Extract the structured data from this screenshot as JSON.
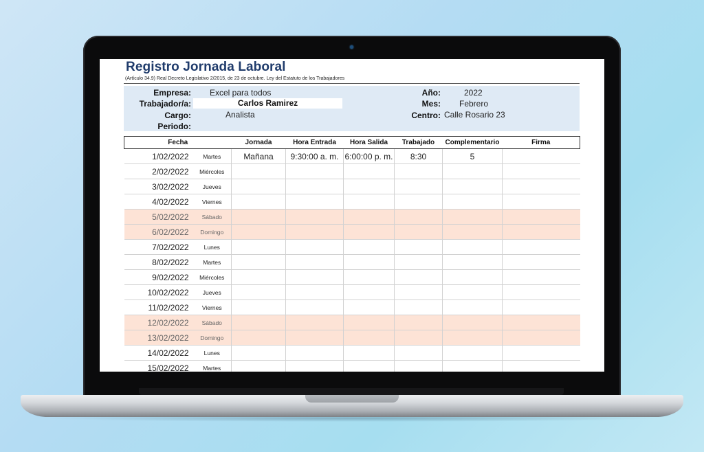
{
  "sheet": {
    "title": "Registro Jornada Laboral",
    "subtitle": "(Artículo 34.9) Real Decreto Legislativo 2/2015, de 23 de octubre. Ley del Estatuto de los Trabajadores"
  },
  "info": {
    "empresa_label": "Empresa:",
    "empresa_value": "Excel para todos",
    "trabajador_label": "Trabajador/a:",
    "trabajador_value": "Carlos Ramirez",
    "cargo_label": "Cargo:",
    "cargo_value": "Analista",
    "periodo_label": "Periodo:",
    "anio_label": "Año:",
    "anio_value": "2022",
    "mes_label": "Mes:",
    "mes_value": "Febrero",
    "centro_label": "Centro:",
    "centro_value": "Calle Rosario 23"
  },
  "table": {
    "headers": [
      "Fecha",
      "Jornada",
      "Hora Entrada",
      "Hora Salida",
      "Trabajado",
      "Complementario",
      "Firma"
    ],
    "rows": [
      {
        "date": "1/02/2022",
        "day": "Martes",
        "jornada": "Mañana",
        "entrada": "9:30:00 a. m.",
        "salida": "6:00:00 p. m.",
        "trabajado": "8:30",
        "complementario": "5",
        "firma": "",
        "weekend": false
      },
      {
        "date": "2/02/2022",
        "day": "Miércoles",
        "jornada": "",
        "entrada": "",
        "salida": "",
        "trabajado": "",
        "complementario": "",
        "firma": "",
        "weekend": false
      },
      {
        "date": "3/02/2022",
        "day": "Jueves",
        "jornada": "",
        "entrada": "",
        "salida": "",
        "trabajado": "",
        "complementario": "",
        "firma": "",
        "weekend": false
      },
      {
        "date": "4/02/2022",
        "day": "Viernes",
        "jornada": "",
        "entrada": "",
        "salida": "",
        "trabajado": "",
        "complementario": "",
        "firma": "",
        "weekend": false
      },
      {
        "date": "5/02/2022",
        "day": "Sábado",
        "jornada": "",
        "entrada": "",
        "salida": "",
        "trabajado": "",
        "complementario": "",
        "firma": "",
        "weekend": true
      },
      {
        "date": "6/02/2022",
        "day": "Domingo",
        "jornada": "",
        "entrada": "",
        "salida": "",
        "trabajado": "",
        "complementario": "",
        "firma": "",
        "weekend": true
      },
      {
        "date": "7/02/2022",
        "day": "Lunes",
        "jornada": "",
        "entrada": "",
        "salida": "",
        "trabajado": "",
        "complementario": "",
        "firma": "",
        "weekend": false
      },
      {
        "date": "8/02/2022",
        "day": "Martes",
        "jornada": "",
        "entrada": "",
        "salida": "",
        "trabajado": "",
        "complementario": "",
        "firma": "",
        "weekend": false
      },
      {
        "date": "9/02/2022",
        "day": "Miércoles",
        "jornada": "",
        "entrada": "",
        "salida": "",
        "trabajado": "",
        "complementario": "",
        "firma": "",
        "weekend": false
      },
      {
        "date": "10/02/2022",
        "day": "Jueves",
        "jornada": "",
        "entrada": "",
        "salida": "",
        "trabajado": "",
        "complementario": "",
        "firma": "",
        "weekend": false
      },
      {
        "date": "11/02/2022",
        "day": "Viernes",
        "jornada": "",
        "entrada": "",
        "salida": "",
        "trabajado": "",
        "complementario": "",
        "firma": "",
        "weekend": false
      },
      {
        "date": "12/02/2022",
        "day": "Sábado",
        "jornada": "",
        "entrada": "",
        "salida": "",
        "trabajado": "",
        "complementario": "",
        "firma": "",
        "weekend": true
      },
      {
        "date": "13/02/2022",
        "day": "Domingo",
        "jornada": "",
        "entrada": "",
        "salida": "",
        "trabajado": "",
        "complementario": "",
        "firma": "",
        "weekend": true
      },
      {
        "date": "14/02/2022",
        "day": "Lunes",
        "jornada": "",
        "entrada": "",
        "salida": "",
        "trabajado": "",
        "complementario": "",
        "firma": "",
        "weekend": false
      },
      {
        "date": "15/02/2022",
        "day": "Martes",
        "jornada": "",
        "entrada": "",
        "salida": "",
        "trabajado": "",
        "complementario": "",
        "firma": "",
        "weekend": false
      }
    ]
  },
  "colors": {
    "title": "#1f3b6b",
    "info_background": "#dfeaf5",
    "weekend_background": "#fde3d6"
  }
}
